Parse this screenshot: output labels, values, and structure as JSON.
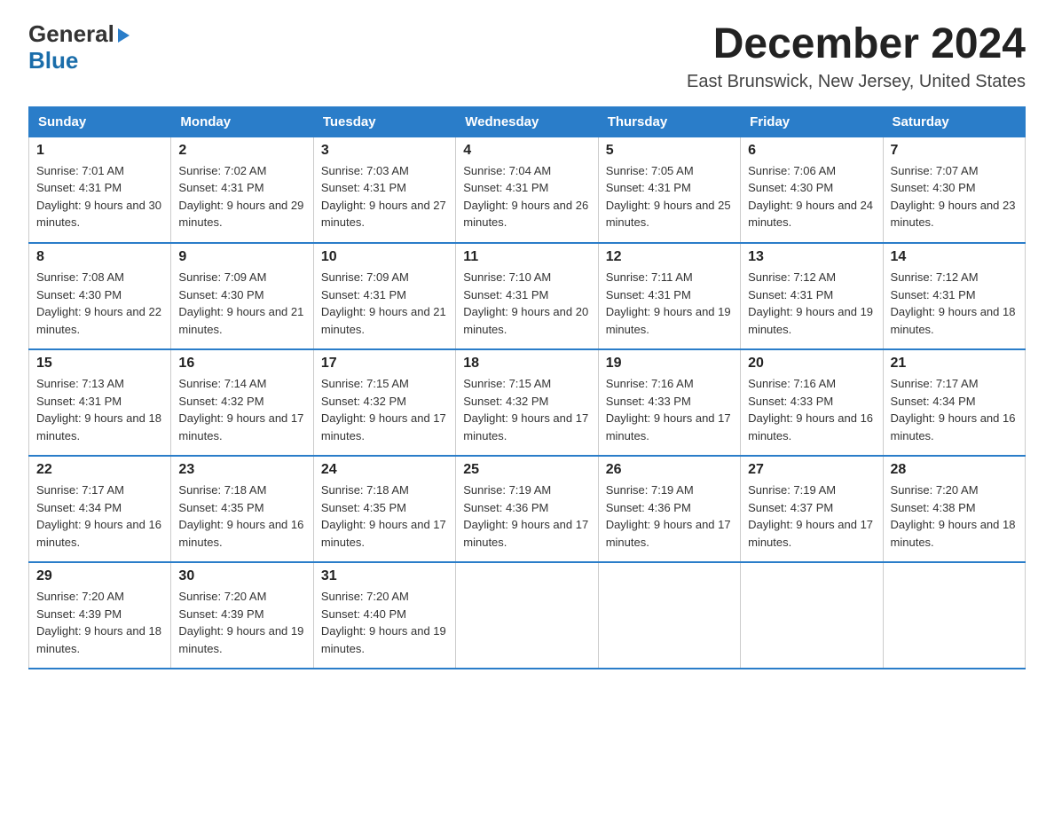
{
  "header": {
    "logo_line1": "General",
    "logo_line2": "Blue",
    "month_title": "December 2024",
    "location": "East Brunswick, New Jersey, United States"
  },
  "days_of_week": [
    "Sunday",
    "Monday",
    "Tuesday",
    "Wednesday",
    "Thursday",
    "Friday",
    "Saturday"
  ],
  "weeks": [
    [
      {
        "day": "1",
        "sunrise": "7:01 AM",
        "sunset": "4:31 PM",
        "daylight": "9 hours and 30 minutes."
      },
      {
        "day": "2",
        "sunrise": "7:02 AM",
        "sunset": "4:31 PM",
        "daylight": "9 hours and 29 minutes."
      },
      {
        "day": "3",
        "sunrise": "7:03 AM",
        "sunset": "4:31 PM",
        "daylight": "9 hours and 27 minutes."
      },
      {
        "day": "4",
        "sunrise": "7:04 AM",
        "sunset": "4:31 PM",
        "daylight": "9 hours and 26 minutes."
      },
      {
        "day": "5",
        "sunrise": "7:05 AM",
        "sunset": "4:31 PM",
        "daylight": "9 hours and 25 minutes."
      },
      {
        "day": "6",
        "sunrise": "7:06 AM",
        "sunset": "4:30 PM",
        "daylight": "9 hours and 24 minutes."
      },
      {
        "day": "7",
        "sunrise": "7:07 AM",
        "sunset": "4:30 PM",
        "daylight": "9 hours and 23 minutes."
      }
    ],
    [
      {
        "day": "8",
        "sunrise": "7:08 AM",
        "sunset": "4:30 PM",
        "daylight": "9 hours and 22 minutes."
      },
      {
        "day": "9",
        "sunrise": "7:09 AM",
        "sunset": "4:30 PM",
        "daylight": "9 hours and 21 minutes."
      },
      {
        "day": "10",
        "sunrise": "7:09 AM",
        "sunset": "4:31 PM",
        "daylight": "9 hours and 21 minutes."
      },
      {
        "day": "11",
        "sunrise": "7:10 AM",
        "sunset": "4:31 PM",
        "daylight": "9 hours and 20 minutes."
      },
      {
        "day": "12",
        "sunrise": "7:11 AM",
        "sunset": "4:31 PM",
        "daylight": "9 hours and 19 minutes."
      },
      {
        "day": "13",
        "sunrise": "7:12 AM",
        "sunset": "4:31 PM",
        "daylight": "9 hours and 19 minutes."
      },
      {
        "day": "14",
        "sunrise": "7:12 AM",
        "sunset": "4:31 PM",
        "daylight": "9 hours and 18 minutes."
      }
    ],
    [
      {
        "day": "15",
        "sunrise": "7:13 AM",
        "sunset": "4:31 PM",
        "daylight": "9 hours and 18 minutes."
      },
      {
        "day": "16",
        "sunrise": "7:14 AM",
        "sunset": "4:32 PM",
        "daylight": "9 hours and 17 minutes."
      },
      {
        "day": "17",
        "sunrise": "7:15 AM",
        "sunset": "4:32 PM",
        "daylight": "9 hours and 17 minutes."
      },
      {
        "day": "18",
        "sunrise": "7:15 AM",
        "sunset": "4:32 PM",
        "daylight": "9 hours and 17 minutes."
      },
      {
        "day": "19",
        "sunrise": "7:16 AM",
        "sunset": "4:33 PM",
        "daylight": "9 hours and 17 minutes."
      },
      {
        "day": "20",
        "sunrise": "7:16 AM",
        "sunset": "4:33 PM",
        "daylight": "9 hours and 16 minutes."
      },
      {
        "day": "21",
        "sunrise": "7:17 AM",
        "sunset": "4:34 PM",
        "daylight": "9 hours and 16 minutes."
      }
    ],
    [
      {
        "day": "22",
        "sunrise": "7:17 AM",
        "sunset": "4:34 PM",
        "daylight": "9 hours and 16 minutes."
      },
      {
        "day": "23",
        "sunrise": "7:18 AM",
        "sunset": "4:35 PM",
        "daylight": "9 hours and 16 minutes."
      },
      {
        "day": "24",
        "sunrise": "7:18 AM",
        "sunset": "4:35 PM",
        "daylight": "9 hours and 17 minutes."
      },
      {
        "day": "25",
        "sunrise": "7:19 AM",
        "sunset": "4:36 PM",
        "daylight": "9 hours and 17 minutes."
      },
      {
        "day": "26",
        "sunrise": "7:19 AM",
        "sunset": "4:36 PM",
        "daylight": "9 hours and 17 minutes."
      },
      {
        "day": "27",
        "sunrise": "7:19 AM",
        "sunset": "4:37 PM",
        "daylight": "9 hours and 17 minutes."
      },
      {
        "day": "28",
        "sunrise": "7:20 AM",
        "sunset": "4:38 PM",
        "daylight": "9 hours and 18 minutes."
      }
    ],
    [
      {
        "day": "29",
        "sunrise": "7:20 AM",
        "sunset": "4:39 PM",
        "daylight": "9 hours and 18 minutes."
      },
      {
        "day": "30",
        "sunrise": "7:20 AM",
        "sunset": "4:39 PM",
        "daylight": "9 hours and 19 minutes."
      },
      {
        "day": "31",
        "sunrise": "7:20 AM",
        "sunset": "4:40 PM",
        "daylight": "9 hours and 19 minutes."
      },
      null,
      null,
      null,
      null
    ]
  ]
}
